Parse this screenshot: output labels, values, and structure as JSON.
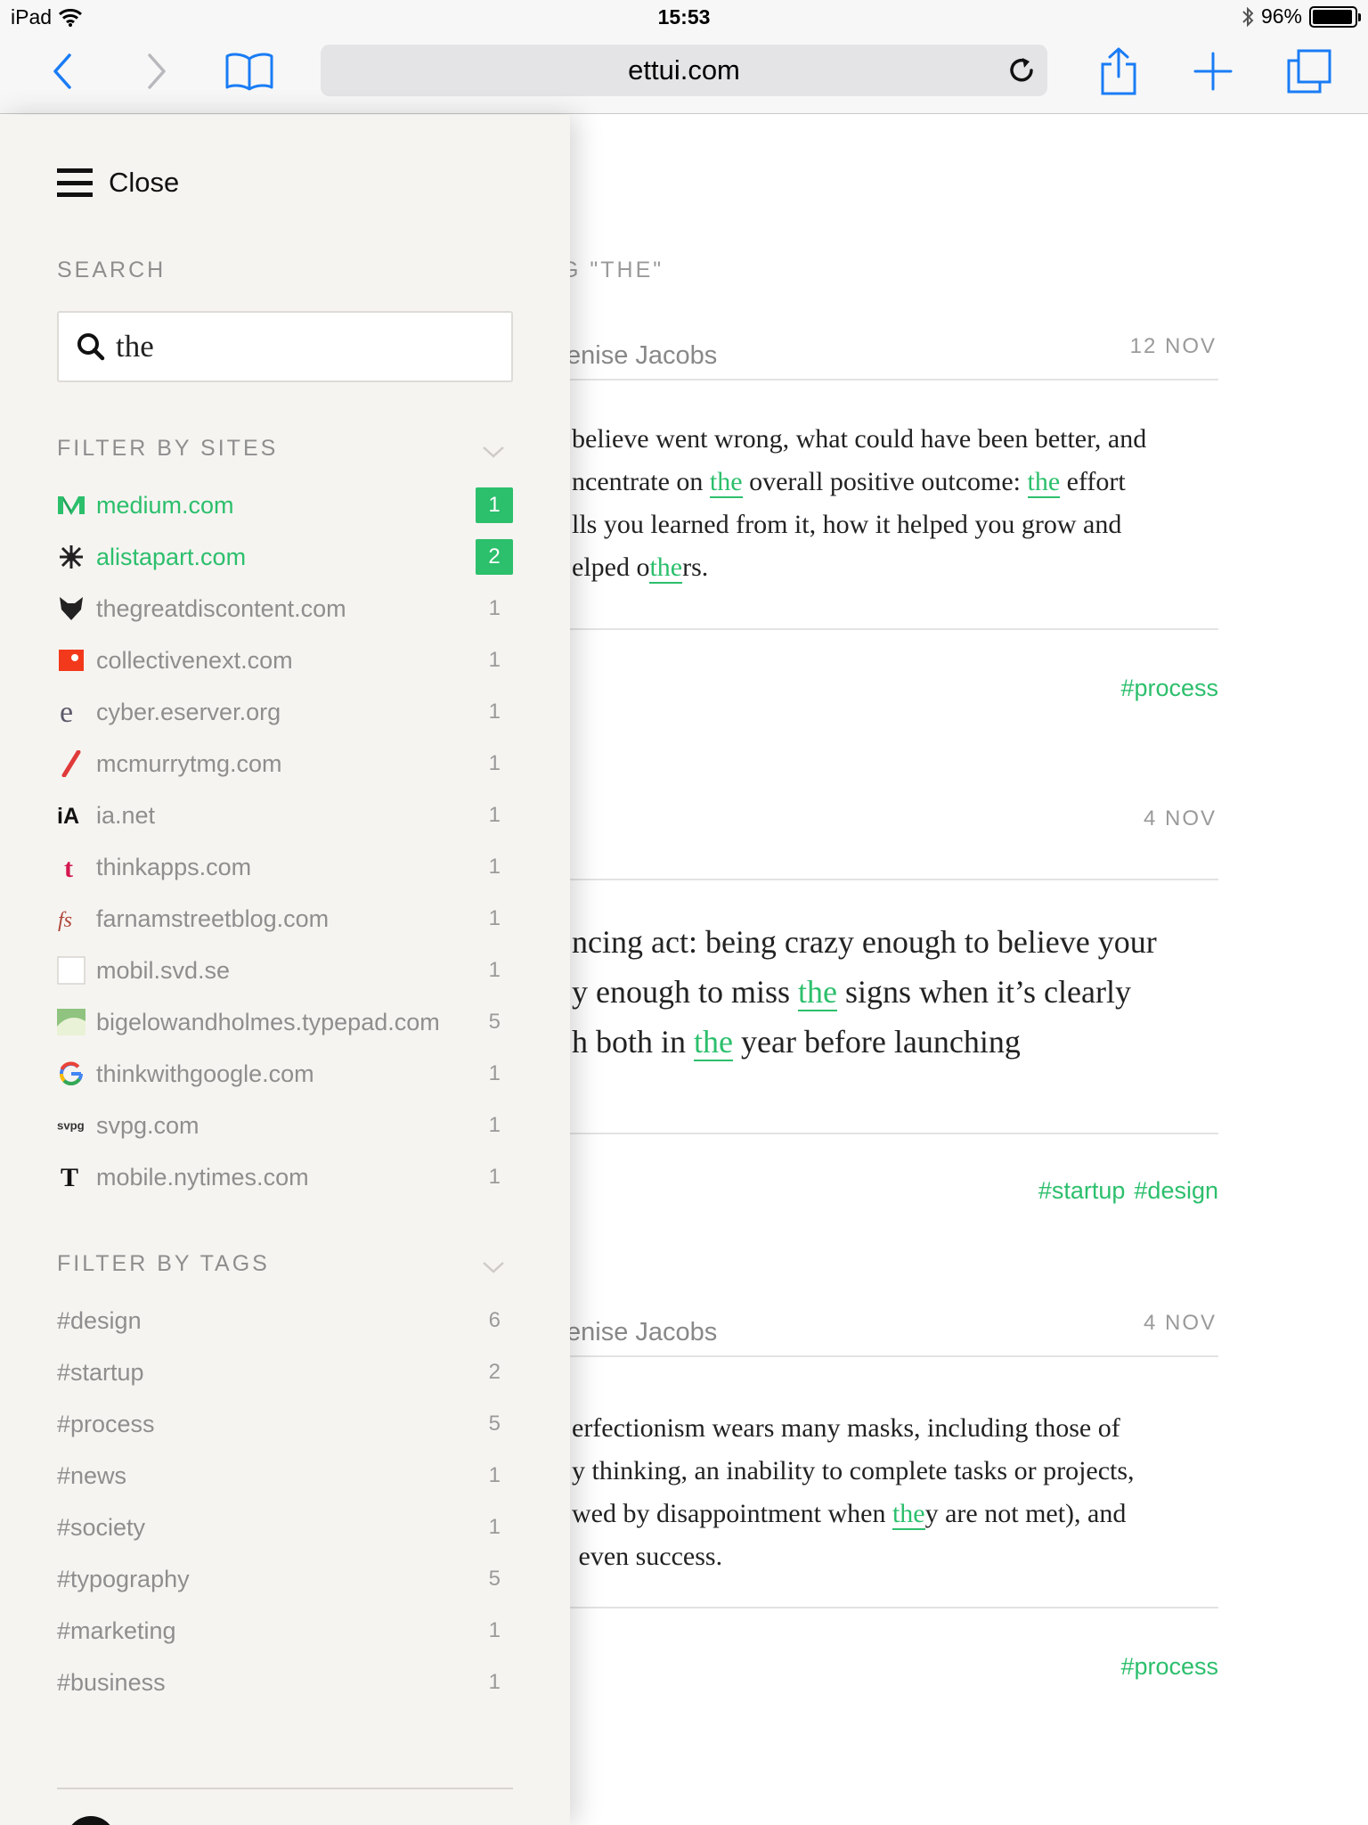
{
  "status_bar": {
    "device": "iPad",
    "time": "15:53",
    "battery": "96%",
    "battery_level": 0.96
  },
  "browser": {
    "url": "ettui.com"
  },
  "sidebar": {
    "close_label": "Close",
    "search_label": "SEARCH",
    "search_value": "the",
    "sites_label": "FILTER BY SITES",
    "sites": [
      {
        "name": "medium.com",
        "count": "1",
        "active": true,
        "icon": "medium-icon"
      },
      {
        "name": "alistapart.com",
        "count": "2",
        "active": true,
        "icon": "alistapart-icon"
      },
      {
        "name": "thegreatdiscontent.com",
        "count": "1",
        "active": false,
        "icon": "fox-icon"
      },
      {
        "name": "collectivenext.com",
        "count": "1",
        "active": false,
        "icon": "collectivenext-icon"
      },
      {
        "name": "cyber.eserver.org",
        "count": "1",
        "active": false,
        "icon": "eserver-icon"
      },
      {
        "name": "mcmurrytmg.com",
        "count": "1",
        "active": false,
        "icon": "slash-icon"
      },
      {
        "name": "ia.net",
        "count": "1",
        "active": false,
        "icon": "ia-icon"
      },
      {
        "name": "thinkapps.com",
        "count": "1",
        "active": false,
        "icon": "thinkapps-icon"
      },
      {
        "name": "farnamstreetblog.com",
        "count": "1",
        "active": false,
        "icon": "fs-icon"
      },
      {
        "name": "mobil.svd.se",
        "count": "1",
        "active": false,
        "icon": "blank-favicon-icon"
      },
      {
        "name": "bigelowandholmes.typepad.com",
        "count": "5",
        "active": false,
        "icon": "typepad-icon"
      },
      {
        "name": "thinkwithgoogle.com",
        "count": "1",
        "active": false,
        "icon": "google-icon"
      },
      {
        "name": "svpg.com",
        "count": "1",
        "active": false,
        "icon": "svpg-icon"
      },
      {
        "name": "mobile.nytimes.com",
        "count": "1",
        "active": false,
        "icon": "nytimes-icon"
      }
    ],
    "tags_label": "FILTER BY TAGS",
    "tags": [
      {
        "name": "#design",
        "count": "6"
      },
      {
        "name": "#startup",
        "count": "2"
      },
      {
        "name": "#process",
        "count": "5"
      },
      {
        "name": "#news",
        "count": "1"
      },
      {
        "name": "#society",
        "count": "1"
      },
      {
        "name": "#typography",
        "count": "5"
      },
      {
        "name": "#marketing",
        "count": "1"
      },
      {
        "name": "#business",
        "count": "1"
      }
    ]
  },
  "main": {
    "heading_visible": "G \"THE\"",
    "articles": [
      {
        "author": "enise Jacobs",
        "date": "12 NOV",
        "lines": [
          [
            {
              "t": "believe went wrong, what could have been better, and"
            }
          ],
          [
            {
              "t": "ncentrate on "
            },
            {
              "t": "the",
              "hl": true
            },
            {
              "t": " overall positive outcome: "
            },
            {
              "t": "the",
              "hl": true
            },
            {
              "t": " effort"
            }
          ],
          [
            {
              "t": "lls you learned from it, how it helped you grow and"
            }
          ],
          [
            {
              "t": "elped o"
            },
            {
              "t": "the",
              "hl": true
            },
            {
              "t": "rs."
            }
          ]
        ],
        "tags": [
          "#process"
        ]
      },
      {
        "author": "",
        "date": "4 NOV",
        "lines": [
          [
            {
              "t": "ncing act: being crazy enough to believe your"
            }
          ],
          [
            {
              "t": "y enough to miss "
            },
            {
              "t": "the",
              "hl": true
            },
            {
              "t": " signs when it’s clearly"
            }
          ],
          [
            {
              "t": "h both in "
            },
            {
              "t": "the",
              "hl": true
            },
            {
              "t": " year before launching"
            }
          ]
        ],
        "tags": [
          "#startup",
          "#design"
        ]
      },
      {
        "author": "enise Jacobs",
        "date": "4 NOV",
        "lines": [
          [
            {
              "t": "erfectionism wears many masks, including those of"
            }
          ],
          [
            {
              "t": "y thinking, an inability to complete tasks or projects,"
            }
          ],
          [
            {
              "t": "wed by disappointment when "
            },
            {
              "t": "the",
              "hl": true
            },
            {
              "t": "y are not met), and"
            }
          ],
          [
            {
              "t": " even success."
            }
          ]
        ],
        "tags": [
          "#process"
        ]
      }
    ]
  },
  "colors": {
    "accent": "#2cbf6c",
    "ios_blue": "#1a7cf5",
    "sidebar_bg": "#f6f4f1"
  }
}
